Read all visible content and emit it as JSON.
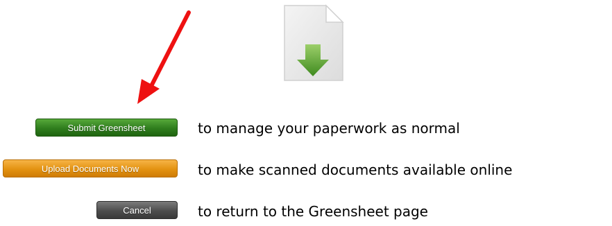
{
  "icons": {
    "document": "download-document-icon",
    "annotation": "red-arrow"
  },
  "colors": {
    "submit_button": "#2f7d1d",
    "upload_button": "#e39211",
    "cancel_button": "#4d4d4d",
    "annotation_arrow": "#ee1111",
    "download_arrow": "#5a9a32"
  },
  "actions": [
    {
      "button_label": "Submit Greensheet",
      "description": "to manage your paperwork as normal"
    },
    {
      "button_label": "Upload Documents Now",
      "description": "to make scanned documents available online"
    },
    {
      "button_label": "Cancel",
      "description": "to return to the Greensheet page"
    }
  ]
}
